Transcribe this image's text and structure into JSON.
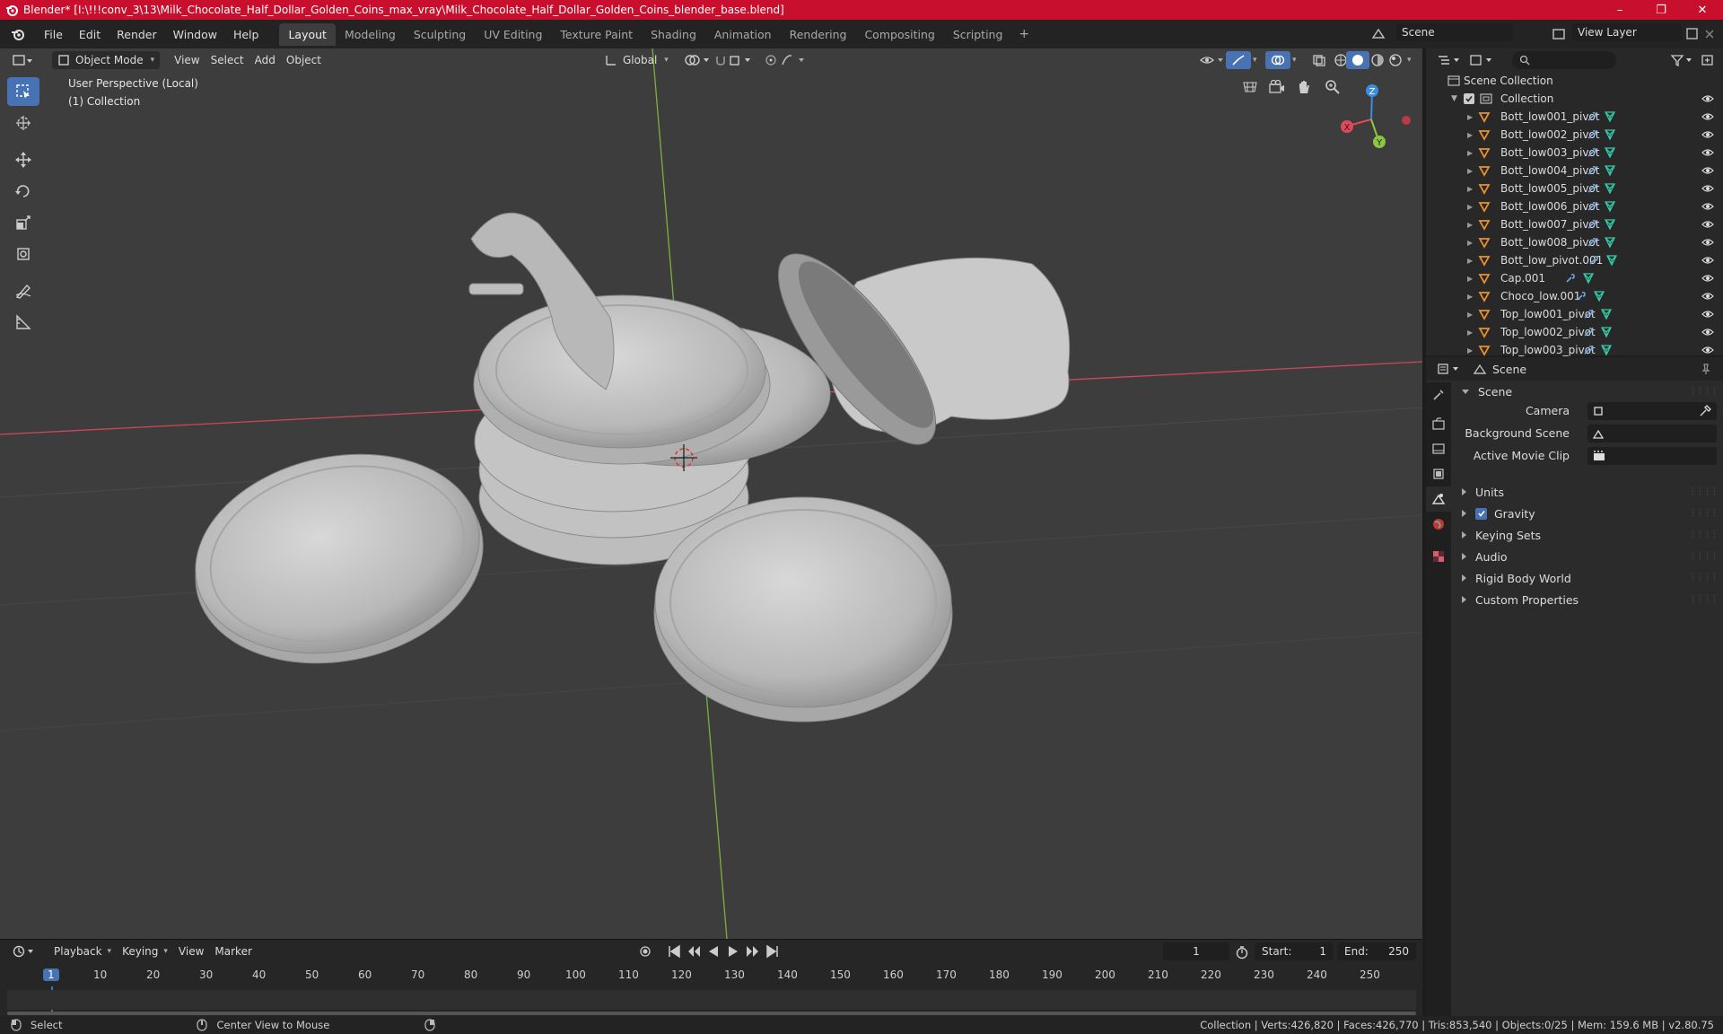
{
  "window": {
    "title": "Blender* [I:\\!!!conv_3\\13\\Milk_Chocolate_Half_Dollar_Golden_Coins_max_vray\\Milk_Chocolate_Half_Dollar_Golden_Coins_blender_base.blend]",
    "controls": [
      "–",
      "❐",
      "✕"
    ]
  },
  "menu": [
    "File",
    "Edit",
    "Render",
    "Window",
    "Help"
  ],
  "workspaces": [
    "Layout",
    "Modeling",
    "Sculpting",
    "UV Editing",
    "Texture Paint",
    "Shading",
    "Animation",
    "Rendering",
    "Compositing",
    "Scripting"
  ],
  "active_workspace": "Layout",
  "scene_name": "Scene",
  "view_layer": "View Layer",
  "viewport": {
    "mode": "Object Mode",
    "menus": [
      "View",
      "Select",
      "Add",
      "Object"
    ],
    "transform_orientation": "Global",
    "info_line1": "User Perspective (Local)",
    "info_line2": "(1) Collection",
    "tools": [
      "select-box-icon",
      "cursor-icon",
      "move-icon",
      "rotate-icon",
      "scale-icon",
      "transform-icon",
      "annotate-icon",
      "measure-icon"
    ],
    "gizmo": {
      "x": "X",
      "y": "Y",
      "z": "Z"
    }
  },
  "timeline": {
    "menus": [
      "Playback",
      "Keying",
      "View",
      "Marker"
    ],
    "current_frame": "1",
    "start_label": "Start:",
    "start": "1",
    "end_label": "End:",
    "end": "250",
    "ticks": [
      "1",
      "10",
      "20",
      "30",
      "40",
      "50",
      "60",
      "70",
      "80",
      "90",
      "100",
      "110",
      "120",
      "130",
      "140",
      "150",
      "160",
      "170",
      "180",
      "190",
      "200",
      "210",
      "220",
      "230",
      "240",
      "250"
    ]
  },
  "statusbar": {
    "select": "Select",
    "center": "Center View to Mouse",
    "stats": "Collection | Verts:426,820 | Faces:426,770 | Tris:853,540 | Objects:0/25 | Mem: 159.6 MB | v2.80.75"
  },
  "outliner": {
    "root": "Scene Collection",
    "collection": "Collection",
    "items": [
      "Bott_low001_pivot",
      "Bott_low002_pivot",
      "Bott_low003_pivot",
      "Bott_low004_pivot",
      "Bott_low005_pivot",
      "Bott_low006_pivot",
      "Bott_low007_pivot",
      "Bott_low008_pivot",
      "Bott_low_pivot.001",
      "Cap.001",
      "Choco_low.001",
      "Top_low001_pivot",
      "Top_low002_pivot",
      "Top_low003_pivot"
    ]
  },
  "properties": {
    "context": "Scene",
    "panel": "Scene",
    "camera_label": "Camera",
    "background_scene_label": "Background Scene",
    "active_movie_clip_label": "Active Movie Clip",
    "sections": [
      "Units",
      "Gravity",
      "Keying Sets",
      "Audio",
      "Rigid Body World",
      "Custom Properties"
    ],
    "gravity_checked": true
  },
  "colors": {
    "title_bar": "#c8102e",
    "accent": "#4772b3",
    "x_axis": "#e04a5a",
    "y_axis": "#8cc63f",
    "z_axis": "#3b8de0",
    "object_icon": "#e8912d",
    "modifier_icon": "#6aa8e8",
    "mesh_icon": "#35c9a8"
  }
}
